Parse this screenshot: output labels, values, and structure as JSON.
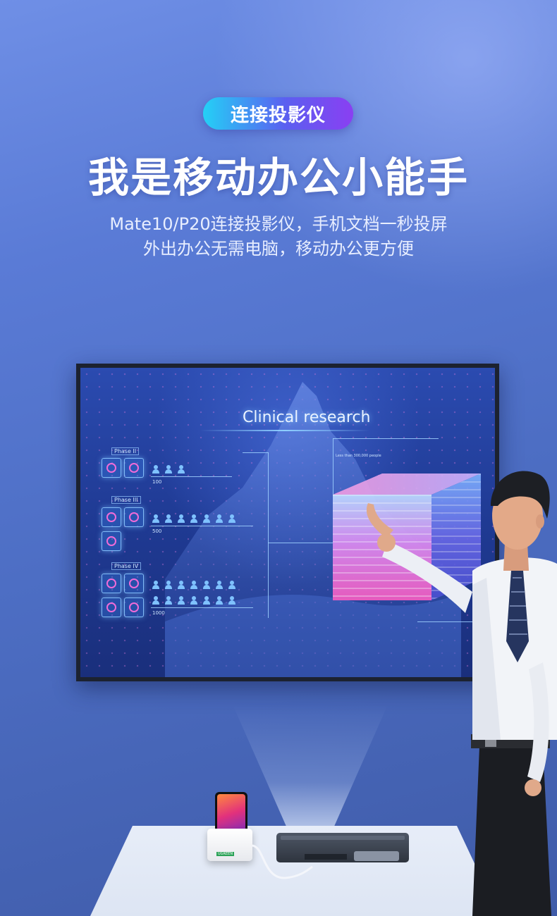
{
  "badge": {
    "label": "连接投影仪"
  },
  "headline": {
    "title": "我是移动办公小能手"
  },
  "subtitle": {
    "line1": "Mate10/P20连接投影仪，手机文档一秒投屏",
    "line2": "外出办公无需电脑，移动办公更方便"
  },
  "screen": {
    "title": "Clinical research",
    "phases": [
      "Phase II",
      "Phase III",
      "Phase IV"
    ],
    "counts": [
      "100",
      "500",
      "1000"
    ],
    "cube_caption": "Less than 300,000 people"
  },
  "product": {
    "dock_brand": "UGREEN"
  },
  "colors": {
    "badge_start": "#24d0f6",
    "badge_end": "#8a3ff2",
    "background": "#5a7bd6"
  }
}
